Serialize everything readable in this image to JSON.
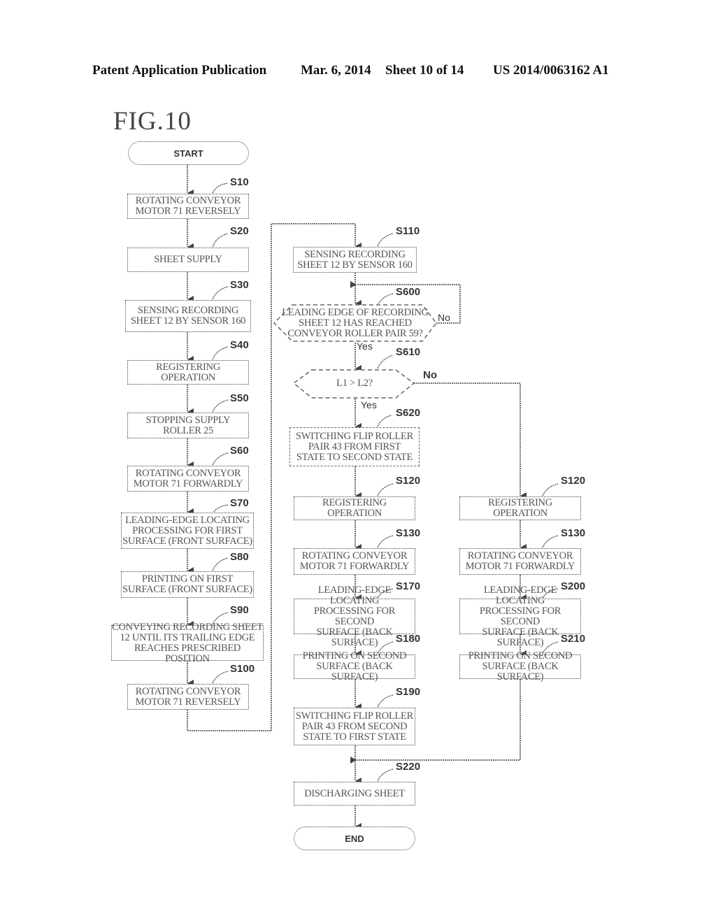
{
  "header": {
    "publication": "Patent Application Publication",
    "date": "Mar. 6, 2014",
    "sheet": "Sheet 10 of 14",
    "number": "US 2014/0063162 A1"
  },
  "figure_title": "FIG.10",
  "terminals": {
    "start": "START",
    "end": "END"
  },
  "steps": {
    "s10": {
      "id": "S10",
      "text": "ROTATING CONVEYOR\nMOTOR 71 REVERSELY"
    },
    "s20": {
      "id": "S20",
      "text": "SHEET SUPPLY"
    },
    "s30": {
      "id": "S30",
      "text": "SENSING RECORDING\nSHEET 12 BY SENSOR 160"
    },
    "s40": {
      "id": "S40",
      "text": "REGISTERING OPERATION"
    },
    "s50": {
      "id": "S50",
      "text": "STOPPING SUPPLY\nROLLER 25"
    },
    "s60": {
      "id": "S60",
      "text": "ROTATING CONVEYOR\nMOTOR 71 FORWARDLY"
    },
    "s70": {
      "id": "S70",
      "text": "LEADING-EDGE LOCATING\nPROCESSING FOR FIRST\nSURFACE (FRONT SURFACE)"
    },
    "s80": {
      "id": "S80",
      "text": "PRINTING ON FIRST\nSURFACE (FRONT SURFACE)"
    },
    "s90": {
      "id": "S90",
      "text": "CONVEYING RECORDING SHEET\n12 UNTIL ITS TRAILING EDGE\nREACHES PRESCRIBED POSITION"
    },
    "s100": {
      "id": "S100",
      "text": "ROTATING CONVEYOR\nMOTOR 71 REVERSELY"
    },
    "s110": {
      "id": "S110",
      "text": "SENSING RECORDING\nSHEET 12 BY SENSOR 160"
    },
    "s600": {
      "id": "S600",
      "text": "LEADING EDGE OF RECORDING\nSHEET 12 HAS REACHED\nCONVEYOR ROLLER PAIR 59?"
    },
    "s610": {
      "id": "S610",
      "text": "L1 > L2?"
    },
    "s620": {
      "id": "S620",
      "text": "SWITCHING FLIP ROLLER\nPAIR 43 FROM FIRST\nSTATE TO SECOND STATE"
    },
    "s120a": {
      "id": "S120",
      "text": "REGISTERING OPERATION"
    },
    "s130a": {
      "id": "S130",
      "text": "ROTATING CONVEYOR\nMOTOR 71 FORWARDLY"
    },
    "s170": {
      "id": "S170",
      "text": "LEADING-EDGE LOCATING\nPROCESSING FOR SECOND\nSURFACE (BACK SURFACE)"
    },
    "s180": {
      "id": "S180",
      "text": "PRINTING ON SECOND\nSURFACE (BACK SURFACE)"
    },
    "s190": {
      "id": "S190",
      "text": "SWITCHING FLIP ROLLER\nPAIR 43 FROM SECOND\nSTATE TO FIRST STATE"
    },
    "s120b": {
      "id": "S120",
      "text": "REGISTERING OPERATION"
    },
    "s130b": {
      "id": "S130",
      "text": "ROTATING CONVEYOR\nMOTOR 71 FORWARDLY"
    },
    "s200": {
      "id": "S200",
      "text": "LEADING-EDGE LOCATING\nPROCESSING FOR SECOND\nSURFACE (BACK SURFACE)"
    },
    "s210": {
      "id": "S210",
      "text": "PRINTING ON SECOND\nSURFACE (BACK SURFACE)"
    },
    "s220": {
      "id": "S220",
      "text": "DISCHARGING SHEET"
    }
  },
  "branch_labels": {
    "s600_no": "No",
    "s600_yes": "Yes",
    "s610_no": "No",
    "s610_yes": "Yes"
  }
}
